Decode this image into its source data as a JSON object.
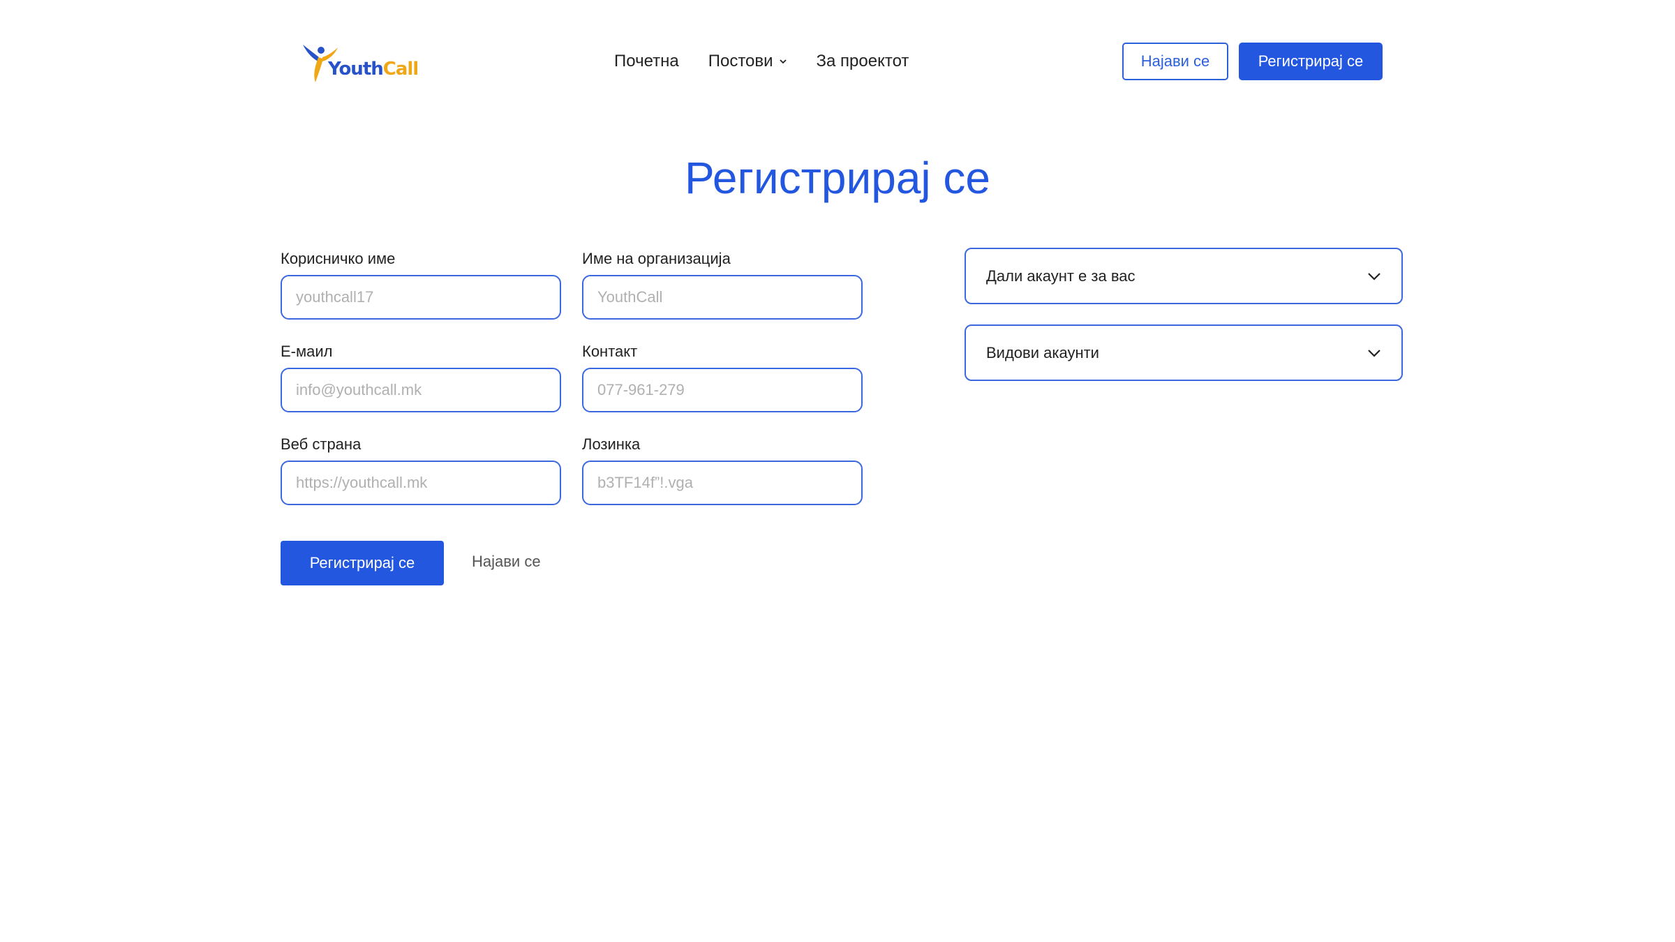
{
  "header": {
    "logo": {
      "text_youth": "Youth",
      "text_call": "Call",
      "brand_blue": "#2852c9",
      "brand_yellow": "#f0a716"
    },
    "nav": [
      {
        "label": "Почетна"
      },
      {
        "label": "Постови",
        "has_dropdown": true
      },
      {
        "label": "За проектот"
      }
    ],
    "login_label": "Најави се",
    "register_label": "Регистрирај се"
  },
  "title": "Регистрирај се",
  "form": {
    "username": {
      "label": "Корисничко име",
      "placeholder": "youthcall17"
    },
    "organization": {
      "label": "Име на организација",
      "placeholder": "YouthCall"
    },
    "email": {
      "label": "Е-маил",
      "placeholder": "info@youthcall.mk"
    },
    "contact": {
      "label": "Контакт",
      "placeholder": "077-961-279"
    },
    "website": {
      "label": "Веб страна",
      "placeholder": "https://youthcall.mk"
    },
    "password": {
      "label": "Лозинка",
      "placeholder": "b3TF14f”!.vga"
    },
    "submit_label": "Регистрирај се",
    "login_link_label": "Најави се"
  },
  "accordions": [
    {
      "label": "Дали акаунт е за вас"
    },
    {
      "label": "Видови акаунти"
    }
  ],
  "colors": {
    "accent": "#2457e0",
    "border": "#3b67e0",
    "text": "#222222",
    "placeholder": "#b0b0b0"
  }
}
